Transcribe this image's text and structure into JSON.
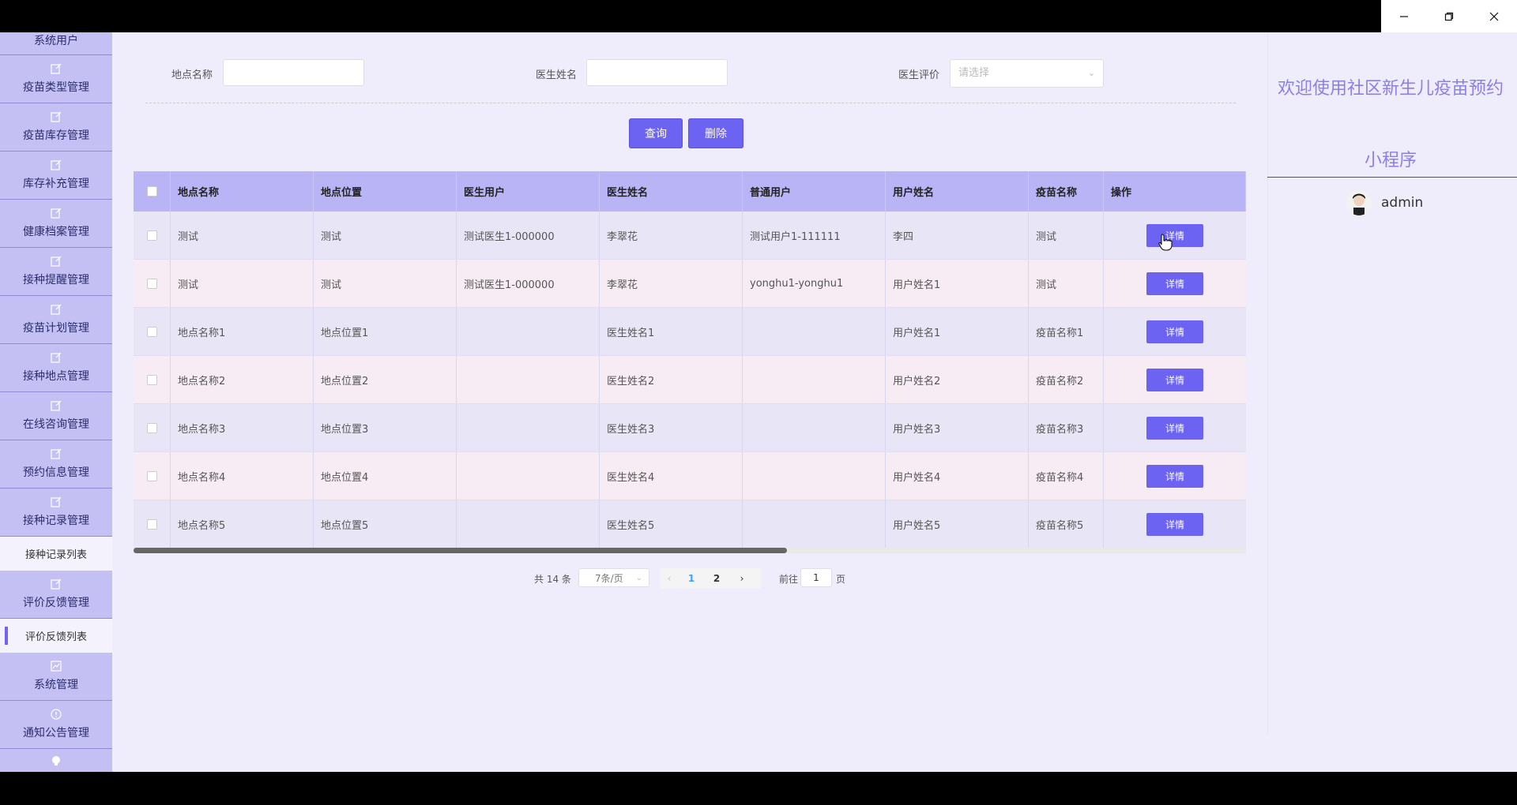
{
  "window": {
    "minimize_icon": "minimize-icon",
    "maximize_icon": "maximize-icon",
    "close_icon": "close-icon"
  },
  "sidebar": {
    "first_item": "系统用户",
    "items": [
      {
        "label": "疫苗类型管理",
        "icon": "edit-icon"
      },
      {
        "label": "疫苗库存管理",
        "icon": "edit-icon"
      },
      {
        "label": "库存补充管理",
        "icon": "edit-icon"
      },
      {
        "label": "健康档案管理",
        "icon": "edit-icon"
      },
      {
        "label": "接种提醒管理",
        "icon": "edit-icon"
      },
      {
        "label": "疫苗计划管理",
        "icon": "edit-icon"
      },
      {
        "label": "接种地点管理",
        "icon": "edit-icon"
      },
      {
        "label": "在线咨询管理",
        "icon": "edit-icon"
      },
      {
        "label": "预约信息管理",
        "icon": "edit-icon"
      },
      {
        "label": "接种记录管理",
        "icon": "edit-icon"
      }
    ],
    "sub1": "接种记录列表",
    "item_feedback": "评价反馈管理",
    "sub2": "评价反馈列表",
    "item_system": "系统管理",
    "item_notice": "通知公告管理"
  },
  "filters": {
    "location_label": "地点名称",
    "location_value": "",
    "doctor_label": "医生姓名",
    "doctor_value": "",
    "rating_label": "医生评价",
    "rating_placeholder": "请选择"
  },
  "actions": {
    "query": "查询",
    "delete": "删除"
  },
  "table": {
    "headers": [
      "地点名称",
      "地点位置",
      "医生用户",
      "医生姓名",
      "普通用户",
      "用户姓名",
      "疫苗名称",
      "操作"
    ],
    "rows": [
      [
        "测试",
        "测试",
        "测试医生1-000000",
        "李翠花",
        "测试用户1-111111",
        "李四",
        "测试"
      ],
      [
        "测试",
        "测试",
        "测试医生1-000000",
        "李翠花",
        "yonghu1-yonghu1",
        "用户姓名1",
        "测试"
      ],
      [
        "地点名称1",
        "地点位置1",
        "",
        "医生姓名1",
        "",
        "用户姓名1",
        "疫苗名称1"
      ],
      [
        "地点名称2",
        "地点位置2",
        "",
        "医生姓名2",
        "",
        "用户姓名2",
        "疫苗名称2"
      ],
      [
        "地点名称3",
        "地点位置3",
        "",
        "医生姓名3",
        "",
        "用户姓名3",
        "疫苗名称3"
      ],
      [
        "地点名称4",
        "地点位置4",
        "",
        "医生姓名4",
        "",
        "用户姓名4",
        "疫苗名称4"
      ],
      [
        "地点名称5",
        "地点位置5",
        "",
        "医生姓名5",
        "",
        "用户姓名5",
        "疫苗名称5"
      ]
    ],
    "detail_label": "详情"
  },
  "pagination": {
    "total": "共 14 条",
    "page_size": "7条/页",
    "pages": [
      "1",
      "2"
    ],
    "current": "1",
    "goto_prefix": "前往",
    "goto_value": "1",
    "goto_suffix": "页"
  },
  "header": {
    "welcome": "欢迎使用社区新生儿疫苗预约小程序",
    "username": "admin"
  },
  "colors": {
    "accent": "#6c63f2",
    "sidebar": "#c4c0f4",
    "header_row": "#b8b4f6",
    "welcome": "#8b7fe8"
  }
}
